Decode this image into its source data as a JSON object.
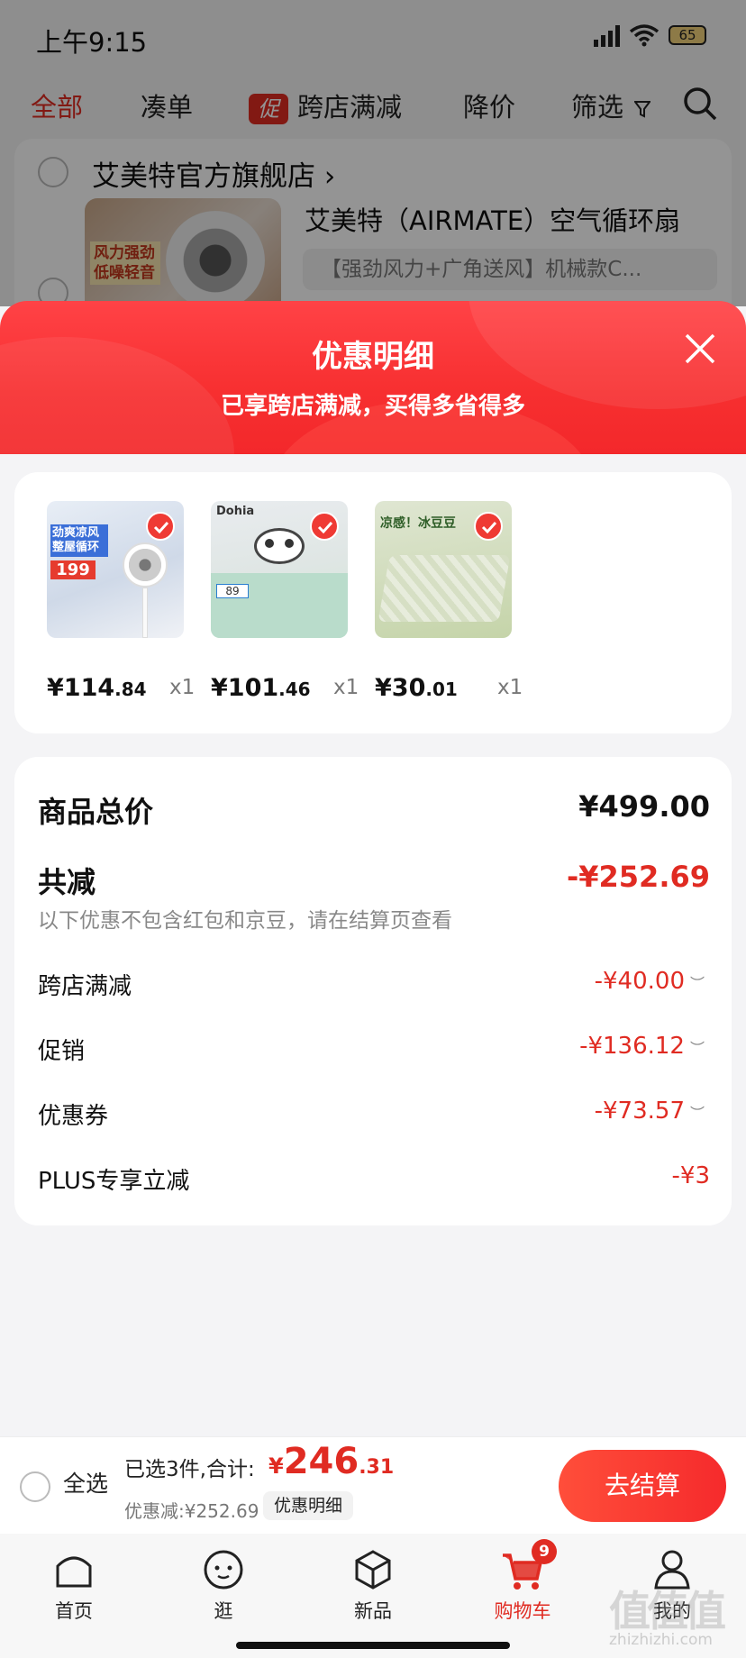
{
  "status_bar": {
    "time": "上午9:15",
    "battery": "65"
  },
  "top_tabs": [
    {
      "label": "全部"
    },
    {
      "label": "凑单"
    },
    {
      "label": "跨店满减",
      "badge": "促"
    },
    {
      "label": "降价"
    },
    {
      "label": "筛选"
    }
  ],
  "store": {
    "name": "艾美特官方旗舰店",
    "product_title": "艾美特（AIRMATE）空气循环扇",
    "product_spec": "【强劲风力+广角送风】机械款C...",
    "thumb_tag": "风力强劲 低噪轻音"
  },
  "sheet": {
    "title": "优惠明细",
    "subtitle": "已享跨店满减，买得多省得多"
  },
  "items": [
    {
      "price_int": "¥114",
      "price_dec": ".84",
      "qty": "x1",
      "img_text": "劲爽凉风 整屋循环",
      "img_price": "199"
    },
    {
      "price_int": "¥101",
      "price_dec": ".46",
      "qty": "x1",
      "img_text": "Dohia",
      "img_price": "89"
    },
    {
      "price_int": "¥30",
      "price_dec": ".01",
      "qty": "x1",
      "img_text": "凉感！冰豆豆",
      "img_price": ""
    }
  ],
  "summary": {
    "total_label": "商品总价",
    "total_value": "¥499.00",
    "reduce_label": "共减",
    "reduce_value": "-¥252.69",
    "note": "以下优惠不包含红包和京豆，请在结算页查看",
    "lines": [
      {
        "label": "跨店满减",
        "value": "-¥40.00"
      },
      {
        "label": "促销",
        "value": "-¥136.12"
      },
      {
        "label": "优惠券",
        "value": "-¥73.57"
      },
      {
        "label": "PLUS专享立减",
        "value": "-¥3"
      }
    ]
  },
  "checkout": {
    "select_all": "全选",
    "selected_text": "已选3件,合计:",
    "total_yen": "¥",
    "total_int": "246",
    "total_dec": ".31",
    "discount_text": "优惠减:¥252.69",
    "detail_chip": "优惠明细",
    "button": "去结算"
  },
  "tabbar": [
    {
      "label": "首页"
    },
    {
      "label": "逛"
    },
    {
      "label": "新品"
    },
    {
      "label": "购物车",
      "badge": "9"
    },
    {
      "label": "我的"
    }
  ],
  "watermark": {
    "text": "值值值",
    "url": "zhizhizhi.com"
  },
  "colors": {
    "accent": "#e02b22",
    "sheet_red": "#f72f30"
  }
}
